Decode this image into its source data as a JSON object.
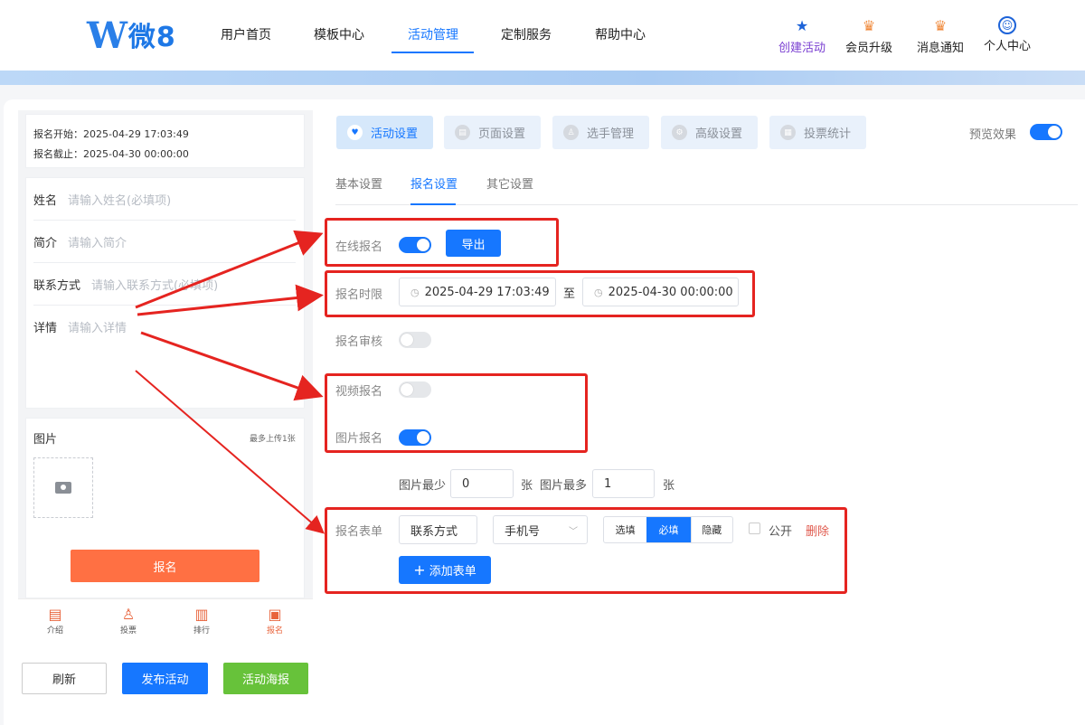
{
  "header": {
    "logo_mark": "W",
    "logo_text": "微8",
    "nav": [
      "用户首页",
      "模板中心",
      "活动管理",
      "定制服务",
      "帮助中心"
    ],
    "icons": [
      {
        "label": "创建活动",
        "icon": "star-icon"
      },
      {
        "label": "会员升级",
        "icon": "crown-icon"
      },
      {
        "label": "消息通知",
        "icon": "bell-icon"
      },
      {
        "label": "个人中心",
        "icon": "user-icon"
      }
    ]
  },
  "preview": {
    "start": "报名开始：2025-04-29 17:03:49",
    "end": "报名截止：2025-04-30 00:00:00",
    "fields": [
      {
        "label": "姓名",
        "placeholder": "请输入姓名(必填项)"
      },
      {
        "label": "简介",
        "placeholder": "请输入简介"
      },
      {
        "label": "联系方式",
        "placeholder": "请输入联系方式(必填项)"
      },
      {
        "label": "详情",
        "placeholder": "请输入详情"
      }
    ],
    "image_label": "图片",
    "image_hint": "最多上传1张",
    "signup_btn": "报名",
    "tabbar": [
      "介绍",
      "投票",
      "排行",
      "报名"
    ],
    "refresh": "刷新",
    "publish": "发布活动",
    "poster": "活动海报"
  },
  "main": {
    "tabs": [
      "活动设置",
      "页面设置",
      "选手管理",
      "高级设置",
      "投票统计"
    ],
    "preview_label": "预览效果",
    "subtabs": [
      "基本设置",
      "报名设置",
      "其它设置"
    ],
    "online_signup": "在线报名",
    "export": "导出",
    "time_limit": "报名时限",
    "start_time": "2025-04-29 17:03:49",
    "to": "至",
    "end_time": "2025-04-30 00:00:00",
    "review": "报名审核",
    "video_signup": "视频报名",
    "image_signup": "图片报名",
    "min_label": "图片最少",
    "min_value": "0",
    "unit": "张",
    "max_label": "图片最多",
    "max_value": "1",
    "form_label": "报名表单",
    "form_field": "联系方式",
    "form_type": "手机号",
    "opt_optional": "选填",
    "opt_required": "必填",
    "opt_hidden": "隐藏",
    "public": "公开",
    "delete": "删除",
    "add_form": "添加表单"
  },
  "colors": {
    "accent": "#1677ff",
    "signup": "#ff7043",
    "poster": "#67c23a",
    "annotation": "#e52420"
  }
}
